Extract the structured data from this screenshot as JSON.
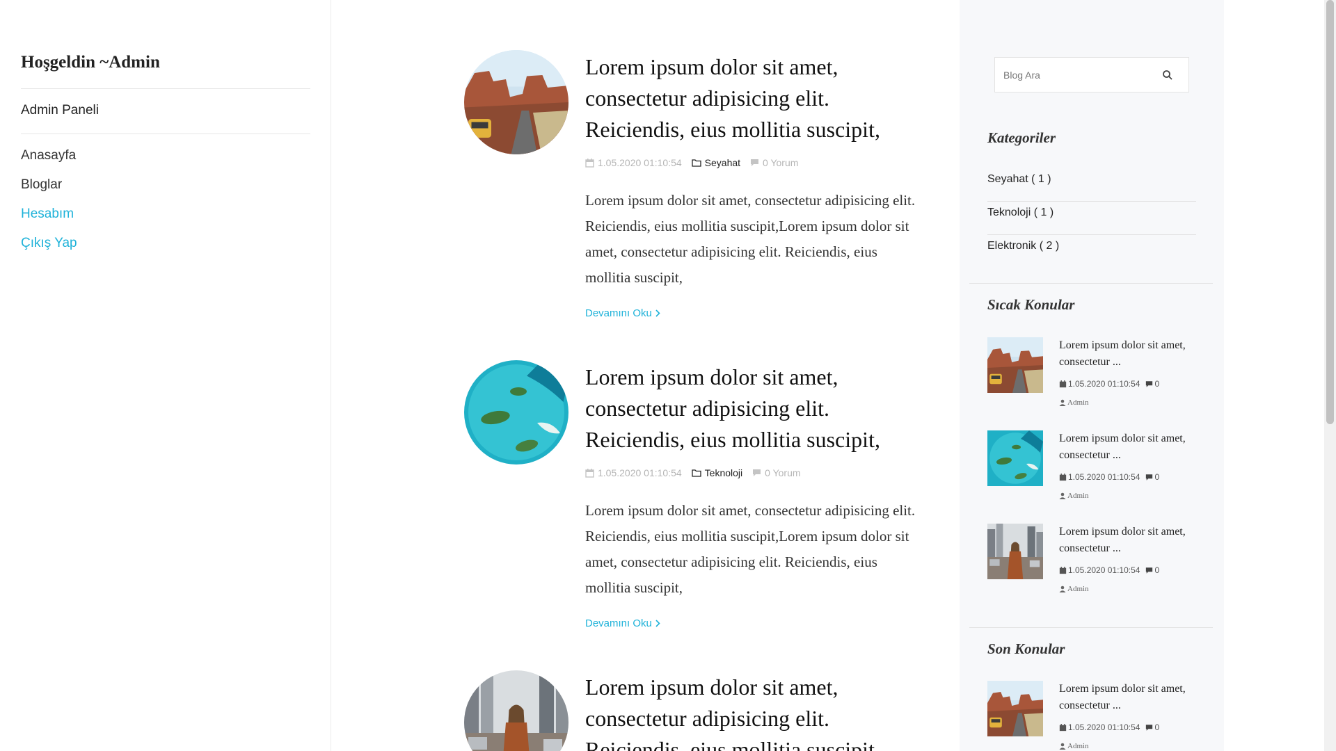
{
  "sidebar": {
    "welcome": "Hoşgeldin ~Admin",
    "admin_panel": "Admin Paneli",
    "nav": [
      "Anasayfa",
      "Bloglar",
      "Hesabım",
      "Çıkış Yap"
    ]
  },
  "posts": [
    {
      "title": "Lorem ipsum dolor sit amet, consectetur adipisicing elit. Reiciendis, eius mollitia suscipit,",
      "date": "1.05.2020 01:10:54",
      "category": "Seyahat",
      "comments": "0 Yorum",
      "excerpt": "Lorem ipsum dolor sit amet, consectetur adipisicing elit. Reiciendis, eius mollitia suscipit,Lorem ipsum dolor sit amet, consectetur adipisicing elit. Reiciendis, eius mollitia suscipit,",
      "read_more": "Devamını Oku",
      "image": "canyon-road-photo"
    },
    {
      "title": "Lorem ipsum dolor sit amet, consectetur adipisicing elit. Reiciendis, eius mollitia suscipit,",
      "date": "1.05.2020 01:10:54",
      "category": "Teknoloji",
      "comments": "0 Yorum",
      "excerpt": "Lorem ipsum dolor sit amet, consectetur adipisicing elit. Reiciendis, eius mollitia suscipit,Lorem ipsum dolor sit amet, consectetur adipisicing elit. Reiciendis, eius mollitia suscipit,",
      "read_more": "Devamını Oku",
      "image": "turquoise-sea-photo"
    },
    {
      "title": "Lorem ipsum dolor sit amet, consectetur adipisicing elit. Reiciendis, eius mollitia suscipit,",
      "image": "city-street-photo"
    }
  ],
  "right": {
    "search_placeholder": "Blog Ara",
    "categories_title": "Kategoriler",
    "categories": [
      "Seyahat ( 1 )",
      "Teknoloji ( 1 )",
      "Elektronik ( 2 )"
    ],
    "hot_title": "Sıcak Konular",
    "hot_posts": [
      {
        "title": "Lorem ipsum dolor sit amet, consectetur ...",
        "date": "1.05.2020 01:10:54",
        "comments": "0",
        "author": "Admin",
        "image": "canyon-road-photo"
      },
      {
        "title": "Lorem ipsum dolor sit amet, consectetur ...",
        "date": "1.05.2020 01:10:54",
        "comments": "0",
        "author": "Admin",
        "image": "turquoise-sea-photo"
      },
      {
        "title": "Lorem ipsum dolor sit amet, consectetur ...",
        "date": "1.05.2020 01:10:54",
        "comments": "0",
        "author": "Admin",
        "image": "city-street-photo"
      }
    ],
    "recent_title": "Son Konular",
    "recent_posts": [
      {
        "title": "Lorem ipsum dolor sit amet, consectetur ...",
        "date": "1.05.2020 01:10:54",
        "comments": "0",
        "author": "Admin",
        "image": "canyon-road-photo"
      }
    ]
  },
  "colors": {
    "accent": "#1eb2d9",
    "sidebar_bg": "#f7f8fa"
  },
  "icons": [
    "calendar-icon",
    "folder-icon",
    "comment-icon",
    "chevron-right-icon",
    "search-icon",
    "user-icon"
  ]
}
